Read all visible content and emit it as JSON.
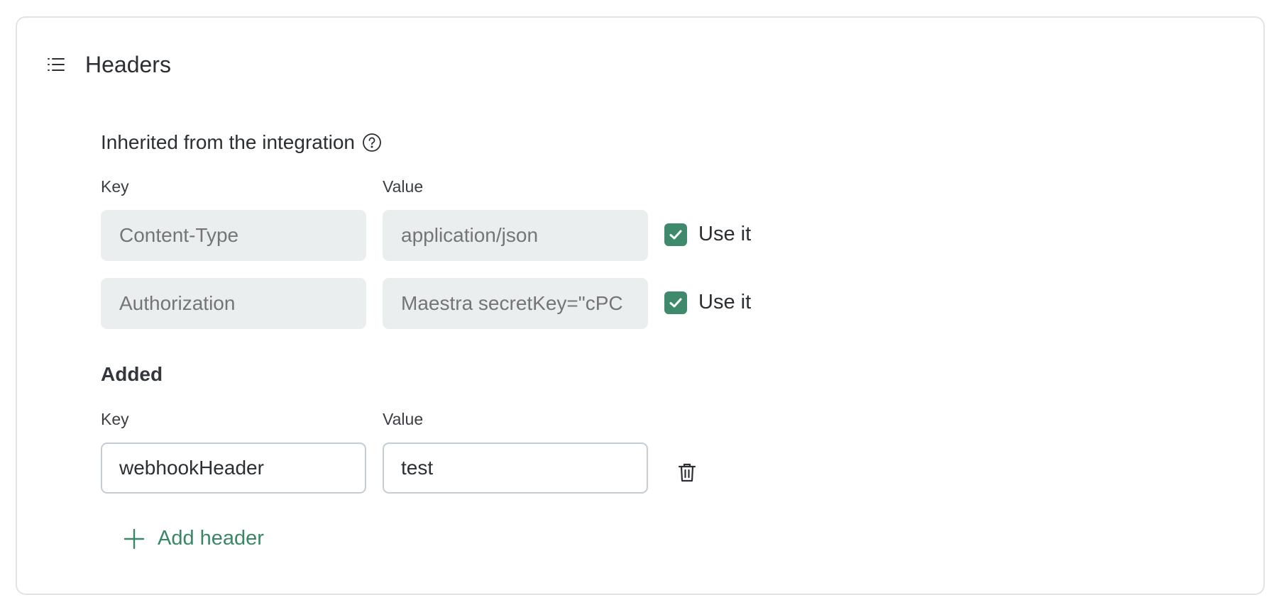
{
  "panel": {
    "title": "Headers",
    "title_icon": "list-icon"
  },
  "inherited": {
    "title": "Inherited from the integration",
    "help_icon": "question-circle-icon",
    "key_label": "Key",
    "value_label": "Value",
    "rows": [
      {
        "key": "Content-Type",
        "value": "application/json",
        "use_label": "Use it",
        "checked": true
      },
      {
        "key": "Authorization",
        "value": "Maestra secretKey=\"cPC",
        "use_label": "Use it",
        "checked": true
      }
    ]
  },
  "added": {
    "title": "Added",
    "key_label": "Key",
    "value_label": "Value",
    "rows": [
      {
        "key": "webhookHeader",
        "value": "test",
        "delete_icon": "trash-icon"
      }
    ],
    "add_label": "Add header",
    "add_icon": "plus-icon"
  },
  "colors": {
    "accent": "#3f8a6c",
    "link": "#3a8766",
    "disabled_bg": "#ebeeef",
    "border": "#c5cdd3"
  }
}
